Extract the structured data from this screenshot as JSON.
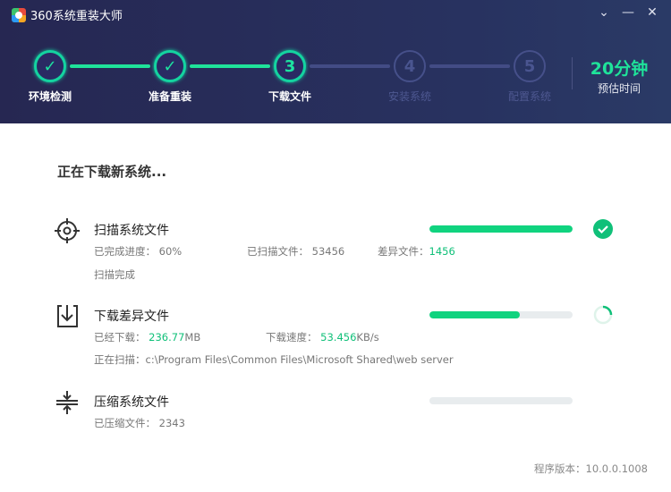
{
  "app": {
    "title": "360系统重装大师"
  },
  "window": {
    "dropdown_icon": "chevron-down-icon",
    "minimize_icon": "minimize-icon",
    "close_icon": "close-icon"
  },
  "steps": [
    {
      "label": "环境检测",
      "state": "done"
    },
    {
      "label": "准备重装",
      "state": "done"
    },
    {
      "label": "下载文件",
      "number": "3",
      "state": "current"
    },
    {
      "label": "安装系统",
      "number": "4",
      "state": "todo"
    },
    {
      "label": "配置系统",
      "number": "5",
      "state": "todo"
    }
  ],
  "estimate": {
    "value": "20分钟",
    "label": "预估时间"
  },
  "main": {
    "heading": "正在下载新系统..."
  },
  "tasks": [
    {
      "name": "扫描系统文件",
      "progress": 1.0,
      "status": "complete",
      "progress_label": "已完成进度：",
      "progress_value": "60%",
      "scanned_label": "已扫描文件：",
      "scanned_value": "53456",
      "diff_label": "差异文件：",
      "diff_value": "1456",
      "status_text": "扫描完成"
    },
    {
      "name": "下载差异文件",
      "progress": 0.63,
      "status": "in-progress",
      "downloaded_label": "已经下载：",
      "downloaded_value": "236.77",
      "downloaded_unit": "MB",
      "speed_label": "下载速度：",
      "speed_value": "53.456",
      "speed_unit": "KB/s",
      "scanning_label": "正在扫描：",
      "scanning_path": "c:\\Program Files\\Common Files\\Microsoft Shared\\web server"
    },
    {
      "name": "压缩系统文件",
      "progress": 0,
      "status": "pending",
      "compressed_label": "已压缩文件：",
      "compressed_value": "2343"
    }
  ],
  "footer": {
    "version": "程序版本：10.0.0.1008"
  },
  "colors": {
    "accent": "#10d37f",
    "header_bg": "#262752"
  }
}
